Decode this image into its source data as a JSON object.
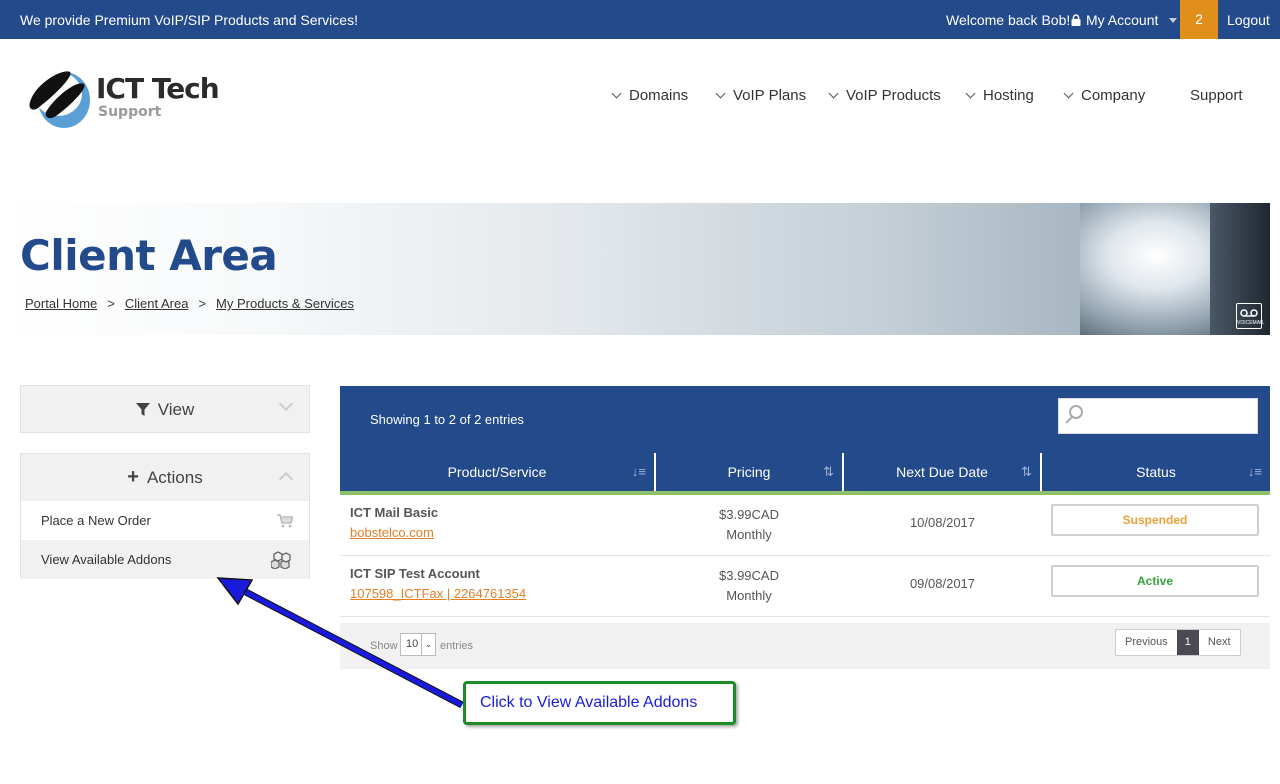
{
  "topbar": {
    "tagline": "We provide Premium VoIP/SIP Products and Services!",
    "welcome": "Welcome back Bob!",
    "account_label": "My Account",
    "cart_count": "2",
    "logout_label": "Logout",
    "color": "#234a8b",
    "cart_color": "#e0901a"
  },
  "logo": {
    "word1": "ICT Tech",
    "word2": "Support"
  },
  "nav": {
    "items": [
      {
        "label": "Domains"
      },
      {
        "label": "VoIP Plans"
      },
      {
        "label": "VoIP Products"
      },
      {
        "label": "Hosting"
      },
      {
        "label": "Company"
      },
      {
        "label": "Support"
      }
    ]
  },
  "banner": {
    "title": "Client Area",
    "breadcrumb": [
      "Portal Home",
      "Client Area",
      "My Products & Services"
    ],
    "separator": ">",
    "voicemail_label": "VOICEMAIL"
  },
  "sidebar": {
    "view_label": "View",
    "actions_label": "Actions",
    "actions": [
      {
        "label": "Place a New Order",
        "icon": "cart-icon"
      },
      {
        "label": "View Available Addons",
        "icon": "cubes-icon"
      }
    ]
  },
  "table": {
    "info": "Showing 1 to 2 of 2 entries",
    "search_placeholder": "",
    "columns": [
      "Product/Service",
      "Pricing",
      "Next Due Date",
      "Status"
    ],
    "rows": [
      {
        "name": "ICT Mail Basic",
        "link": "bobstelco.com",
        "price": "$3.99CAD",
        "cycle": "Monthly",
        "due": "10/08/2017",
        "status": "Suspended"
      },
      {
        "name": "ICT SIP Test Account",
        "link": "107598_ICTFax | 2264761354",
        "price": "$3.99CAD",
        "cycle": "Monthly",
        "due": "09/08/2017",
        "status": "Active"
      }
    ],
    "footer": {
      "show_label": "Show",
      "page_size": "10",
      "entries_label": "entries",
      "prev_label": "Previous",
      "current_page": "1",
      "next_label": "Next"
    }
  },
  "callout": {
    "text": "Click to View Available Addons",
    "border_color": "#1c8a26",
    "arrow_color": "#1a1adf"
  }
}
